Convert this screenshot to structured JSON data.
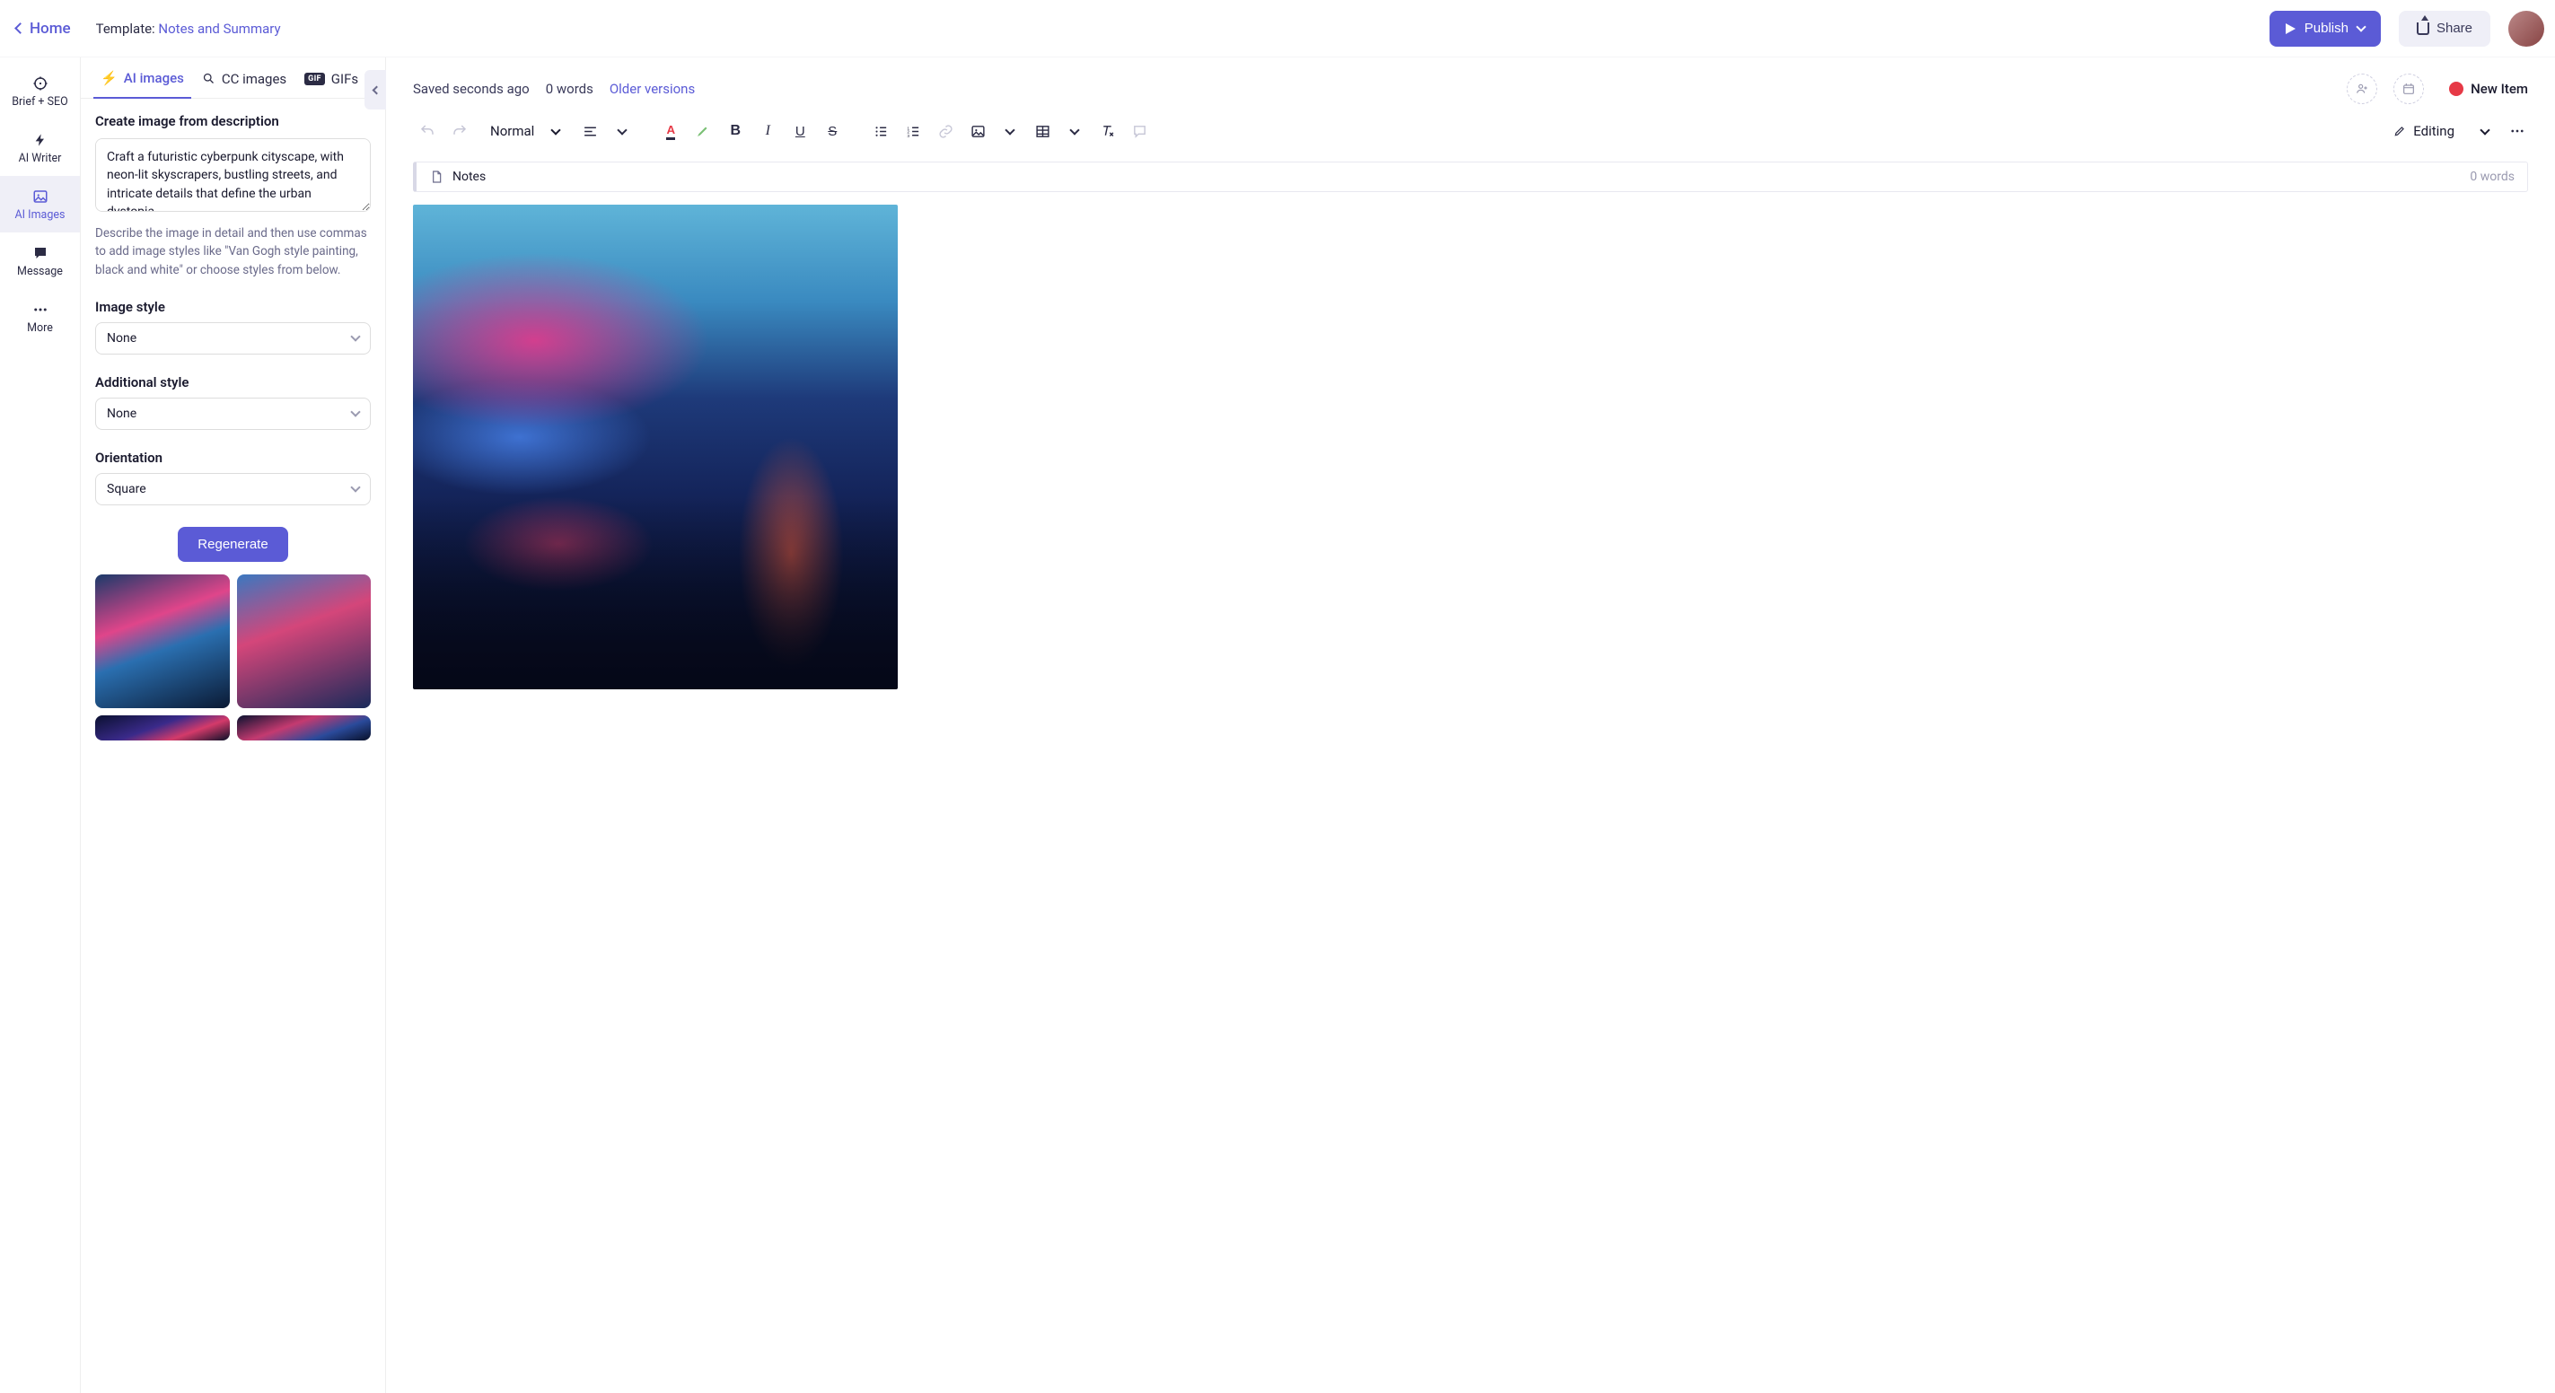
{
  "topbar": {
    "home": "Home",
    "template_prefix": "Template: ",
    "template_name": "Notes and Summary",
    "publish": "Publish",
    "share": "Share"
  },
  "rail": {
    "brief": "Brief + SEO",
    "writer": "AI Writer",
    "images": "AI Images",
    "message": "Message",
    "more": "More"
  },
  "sidebar": {
    "tabs": {
      "ai": "AI images",
      "cc": "CC images",
      "gifs": "GIFs"
    },
    "create_heading": "Create image from description",
    "prompt_value": "Craft a futuristic cyberpunk cityscape, with neon-lit skyscrapers, bustling streets, and intricate details that define the urban dystopia.",
    "hint": "Describe the image in detail and then use commas to add image styles like \"Van Gogh style painting, black and white\" or choose styles from below.",
    "image_style_label": "Image style",
    "image_style_value": "None",
    "additional_style_label": "Additional style",
    "additional_style_value": "None",
    "orientation_label": "Orientation",
    "orientation_value": "Square",
    "regenerate": "Regenerate"
  },
  "editor": {
    "saved": "Saved seconds ago",
    "wordcount_top": "0 words",
    "older_versions": "Older versions",
    "new_item": "New Item",
    "style_name": "Normal",
    "mode": "Editing",
    "notes_title": "Notes",
    "notes_words": "0 words"
  }
}
